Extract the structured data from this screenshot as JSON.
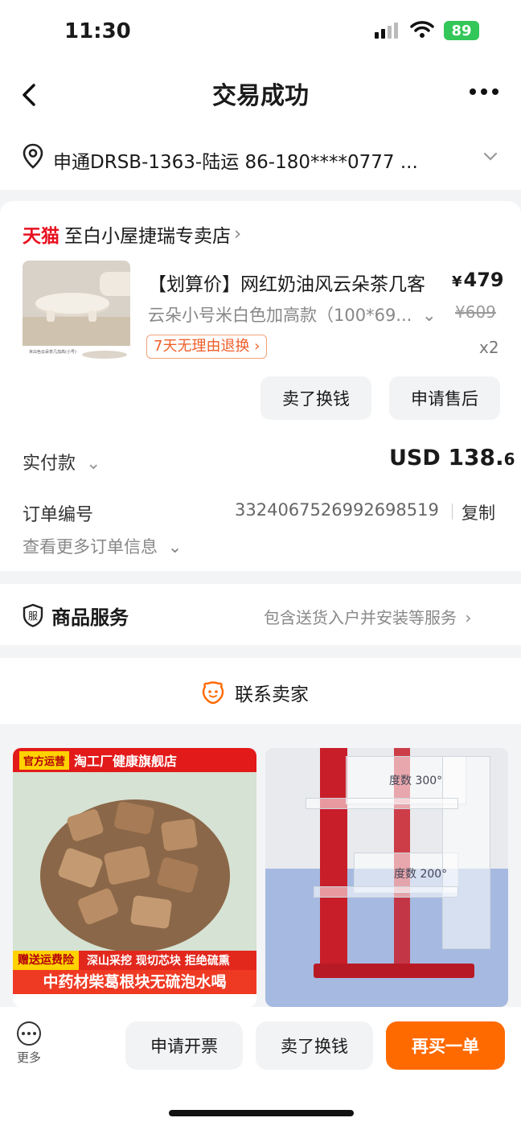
{
  "status_bar": {
    "time": "11:30",
    "battery": "89"
  },
  "nav": {
    "title": "交易成功"
  },
  "address": {
    "text": "申通DRSB-1363-陆运  86-180****0777  ..."
  },
  "shop": {
    "brand": "天猫",
    "name": "至白小屋捷瑞专卖店"
  },
  "product": {
    "title": "【划算价】网红奶油风云朵茶几客",
    "currency_symbol": "¥",
    "price": "479",
    "sku": "云朵小号米白色加高款（100*69...",
    "old_price": "¥609",
    "return_tag": "7天无理由退换",
    "quantity": "x2",
    "thumb_caption": "米白色云朵茶几加高(小号)"
  },
  "actions": {
    "sell": "卖了换钱",
    "after_sale": "申请售后"
  },
  "payment": {
    "label": "实付款",
    "currency": "USD",
    "amount_int": "138.",
    "amount_dec": "6"
  },
  "order": {
    "label": "订单编号",
    "number": "3324067526992698519",
    "copy": "复制",
    "more": "查看更多订单信息"
  },
  "service": {
    "icon_text": "服",
    "label": "商品服务",
    "desc": "包含送货入户并安装等服务"
  },
  "contact": {
    "label": "联系卖家"
  },
  "recommend": [
    {
      "badge": "官方运营",
      "shop": "淘工厂健康旗舰店",
      "strip_tag": "赠送运费险",
      "strip_text": "深山采挖  现切芯块  拒绝硫熏",
      "title": "中药材柴葛根块无硫泡水喝"
    },
    {
      "label_top": "度数 300°",
      "label_bottom": "度数 200°"
    }
  ],
  "bottom": {
    "more": "更多",
    "invoice": "申请开票",
    "sell": "卖了换钱",
    "rebuy": "再买一单"
  },
  "colors": {
    "accent": "#ff6a00",
    "tmall_red": "#e8101f",
    "battery_green": "#33c659"
  }
}
